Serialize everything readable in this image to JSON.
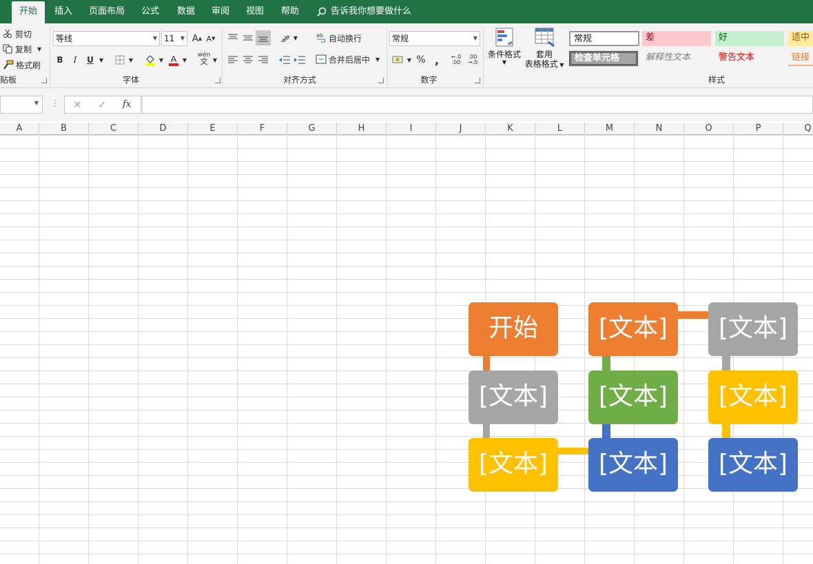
{
  "ribbon_tabs": [
    "开始",
    "插入",
    "页面布局",
    "公式",
    "数据",
    "审阅",
    "视图",
    "帮助"
  ],
  "tell_me": "告诉我你想要做什么",
  "clipboard": {
    "cut": "剪切",
    "copy": "复制",
    "painter": "格式刷",
    "group": "贴板"
  },
  "font": {
    "name": "等线",
    "size": "11",
    "group": "字体"
  },
  "alignment": {
    "wrap": "自动换行",
    "merge": "合并后居中",
    "group": "对齐方式"
  },
  "number": {
    "format": "常规",
    "group": "数字"
  },
  "styles_section": {
    "cond_format": "条件格式",
    "table_format_1": "套用",
    "table_format_2": "表格格式",
    "group": "样式"
  },
  "cell_styles": {
    "normal": "常规",
    "bad": "差",
    "good": "好",
    "neutral": "适中",
    "check": "检查单元格",
    "explanatory": "解释性文本",
    "warning": "警告文本",
    "link": "链接"
  },
  "columns": [
    "A",
    "B",
    "C",
    "D",
    "E",
    "F",
    "G",
    "H",
    "I",
    "J",
    "K",
    "L",
    "M",
    "N",
    "O",
    "P",
    "Q"
  ],
  "smartart": {
    "nodes": [
      "开始",
      "[文本]",
      "[文本]",
      "[文本]",
      "[文本]",
      "[文本]",
      "[文本]",
      "[文本]",
      "[文本]"
    ],
    "colors": {
      "orange": "#ed7d31",
      "gray": "#a5a5a5",
      "yellow": "#ffc000",
      "green": "#70ad47",
      "blue": "#4472c4"
    }
  }
}
